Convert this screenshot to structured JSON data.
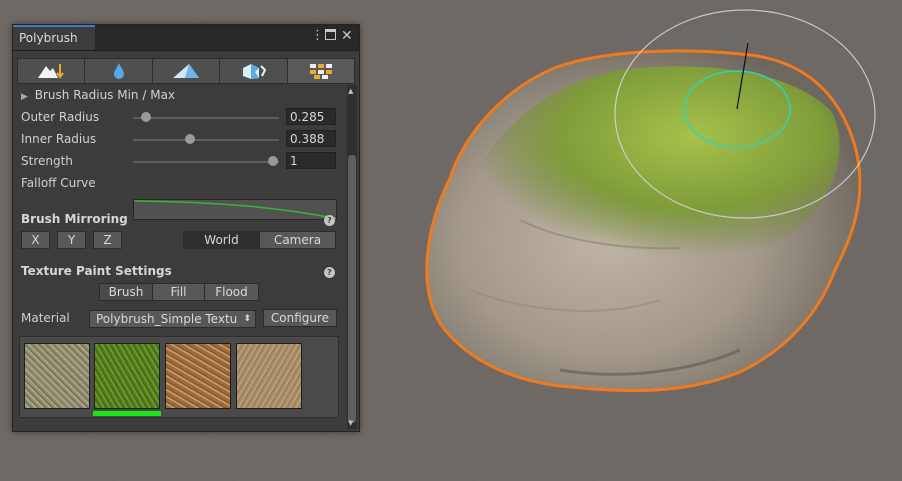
{
  "window": {
    "tab_title": "Polybrush",
    "menu_icon": "kebab-menu-icon",
    "maximize_icon": "maximize-icon",
    "close_icon": "close-icon"
  },
  "toolbar": {
    "tools": [
      {
        "name": "sculpt-mode",
        "icon": "raise-lower-icon"
      },
      {
        "name": "smooth-mode",
        "icon": "droplet-icon"
      },
      {
        "name": "paint-mode",
        "icon": "pyramid-icon"
      },
      {
        "name": "scatter-mode",
        "icon": "prefab-icon"
      },
      {
        "name": "texture-mode",
        "icon": "texture-blocks-icon",
        "selected": true
      }
    ]
  },
  "brush": {
    "radius_header": "Brush Radius Min / Max",
    "outer_radius": {
      "label": "Outer Radius",
      "value": "0.285",
      "fraction": 0.07
    },
    "inner_radius": {
      "label": "Inner Radius",
      "value": "0.388",
      "fraction": 0.39
    },
    "strength": {
      "label": "Strength",
      "value": "1",
      "fraction": 1.0
    },
    "falloff_label": "Falloff Curve",
    "falloff_color": "#3bb33b"
  },
  "mirroring": {
    "title": "Brush Mirroring",
    "axes": [
      "X",
      "Y",
      "Z"
    ],
    "space_options": [
      "World",
      "Camera"
    ],
    "selected_space": "World"
  },
  "texture_paint": {
    "title": "Texture Paint Settings",
    "modes": [
      "Brush",
      "Fill",
      "Flood"
    ],
    "selected_mode": "Brush",
    "material_label": "Material",
    "material_value": "Polybrush_Simple Textu",
    "configure_label": "Configure",
    "swatches": [
      "gravel",
      "moss",
      "dirt",
      "sand"
    ],
    "selected_swatch": 1,
    "selection_color": "#19e619"
  },
  "scene": {
    "outline_color": "#f07a1e",
    "brush_inner_color": "#2fd3b8",
    "brush_outer_color": "#d8d8d8"
  }
}
